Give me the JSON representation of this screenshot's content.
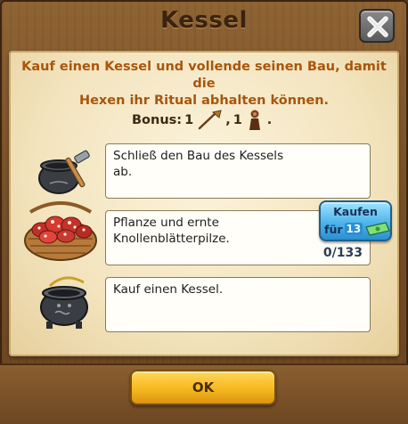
{
  "dialog": {
    "title": "Kessel",
    "close_icon": "close-x-icon",
    "description_line1": "Kauf einen Kessel und vollende seinen Bau, damit die",
    "description_line2": "Hexen ihr Ritual abhalten können.",
    "bonus": {
      "label": "Bonus:",
      "item1_count": "1",
      "item1_icon": "broom-icon",
      "separator": ",",
      "item2_count": "1",
      "item2_icon": "witch-figure-icon",
      "end": "."
    },
    "tasks": [
      {
        "icon": "cauldron-hammer-icon",
        "text_line1": "Schließ den Bau des Kessels",
        "text_line2": "ab."
      },
      {
        "icon": "mushroom-basket-icon",
        "text_line1": "Pflanze und ernte",
        "text_line2": "Knollenblätterpilze.",
        "progress": "0/133",
        "buy_button": {
          "line1": "Kaufen",
          "line2_prefix": "für",
          "cost": "13",
          "currency_icon": "banknote-icon"
        }
      },
      {
        "icon": "cauldron-icon",
        "text_line1": "Kauf einen Kessel."
      }
    ],
    "ok_label": "OK"
  },
  "colors": {
    "frame_wood": "#7a5228",
    "parchment": "#f3e4be",
    "description_text": "#a8560e",
    "buy_button": "#4fb4ea",
    "ok_button": "#f6b81f"
  }
}
